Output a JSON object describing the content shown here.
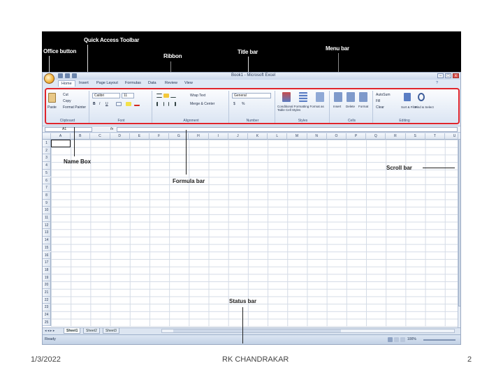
{
  "annotations": {
    "office_button": "Office button",
    "quick_access_toolbar": "Quick Access Toolbar",
    "ribbon": "Ribbon",
    "title_bar": "Title bar",
    "menu_bar": "Menu bar",
    "name_box": "Name Box",
    "formula_bar": "Formula bar",
    "scroll_bar": "Scroll bar",
    "status_bar": "Status bar"
  },
  "window": {
    "title": "Book1 - Microsoft Excel",
    "controls": [
      "–",
      "□",
      "x"
    ]
  },
  "tabs": [
    "Home",
    "Insert",
    "Page Layout",
    "Formulas",
    "Data",
    "Review",
    "View"
  ],
  "ribbon": {
    "clipboard": {
      "label": "Clipboard",
      "paste": "Paste",
      "cut": "Cut",
      "copy": "Copy",
      "format_painter": "Format Painter"
    },
    "font": {
      "label": "Font",
      "font_name": "Calibri",
      "font_size": "11",
      "bold": "B",
      "italic": "I",
      "underline": "U"
    },
    "alignment": {
      "label": "Alignment",
      "wrap_text": "Wrap Text",
      "merge_center": "Merge & Center"
    },
    "number": {
      "label": "Number",
      "format": "General",
      "currency": "$",
      "percent": "%"
    },
    "styles": {
      "label": "Styles",
      "conditional_formatting": "Conditional Formatting",
      "format_as_table": "Format as Table",
      "cell_styles": "Cell Styles"
    },
    "cells": {
      "label": "Cells",
      "insert": "Insert",
      "delete": "Delete",
      "format": "Format"
    },
    "editing": {
      "label": "Editing",
      "autosum": "AutoSum",
      "fill": "Fill",
      "clear": "Clear",
      "sort_filter": "Sort & Filter",
      "find_select": "Find & Select"
    }
  },
  "formula_bar": {
    "name_box_value": "A1",
    "fx": "fx",
    "value": ""
  },
  "grid": {
    "columns": [
      "A",
      "B",
      "C",
      "D",
      "E",
      "F",
      "G",
      "H",
      "I",
      "J",
      "K",
      "L",
      "M",
      "N",
      "O",
      "P",
      "Q",
      "R",
      "S",
      "T",
      "U"
    ],
    "rows": [
      "1",
      "2",
      "3",
      "4",
      "5",
      "6",
      "7",
      "8",
      "9",
      "10",
      "11",
      "12",
      "13",
      "14",
      "15",
      "16",
      "17",
      "18",
      "19",
      "20",
      "21",
      "22",
      "23",
      "24",
      "25"
    ]
  },
  "sheets": [
    "Sheet1",
    "Sheet2",
    "Sheet3"
  ],
  "status": {
    "text": "Ready",
    "zoom": "100%"
  },
  "footer": {
    "date": "1/3/2022",
    "author": "RK CHANDRAKAR",
    "page": "2"
  },
  "colors": {
    "ribbon_highlight": "#e0242c",
    "window_bg": "#dfe8f5",
    "annotation_band": "#000000"
  }
}
